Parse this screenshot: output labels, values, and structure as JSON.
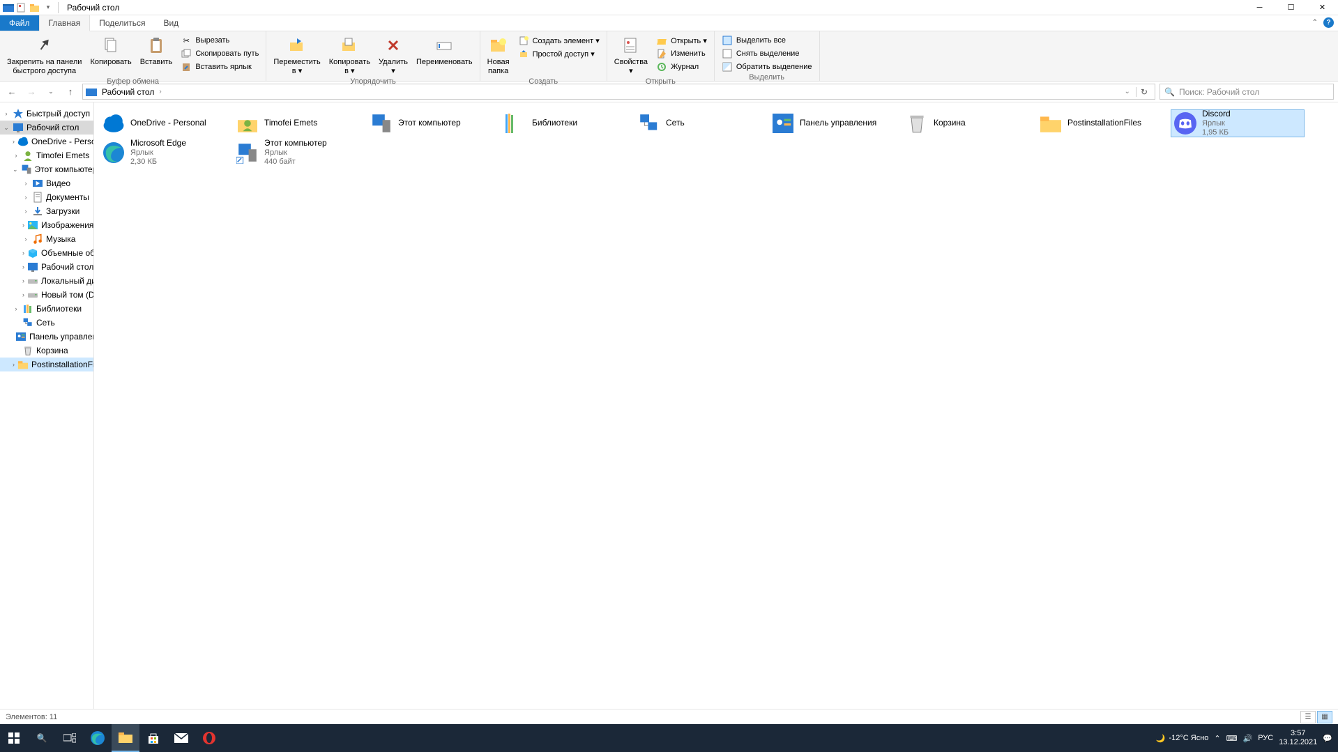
{
  "title": "Рабочий стол",
  "tabs": {
    "file": "Файл",
    "home": "Главная",
    "share": "Поделиться",
    "view": "Вид"
  },
  "ribbon": {
    "clipboard": {
      "title": "Буфер обмена",
      "pin": "Закрепить на панели\nбыстрого доступа",
      "copy": "Копировать",
      "paste": "Вставить",
      "cut": "Вырезать",
      "copypath": "Скопировать путь",
      "pastelnk": "Вставить ярлык"
    },
    "organize": {
      "title": "Упорядочить",
      "moveto": "Переместить\nв ▾",
      "copyto": "Копировать\nв ▾",
      "delete": "Удалить\n▾",
      "rename": "Переименовать"
    },
    "create": {
      "title": "Создать",
      "newfolder": "Новая\nпапка",
      "newitem": "Создать элемент ▾",
      "easyaccess": "Простой доступ ▾"
    },
    "open": {
      "title": "Открыть",
      "properties": "Свойства\n▾",
      "open": "Открыть ▾",
      "edit": "Изменить",
      "history": "Журнал"
    },
    "select": {
      "title": "Выделить",
      "selectall": "Выделить все",
      "selectnone": "Снять выделение",
      "invert": "Обратить выделение"
    }
  },
  "address": {
    "location": "Рабочий стол",
    "search_placeholder": "Поиск: Рабочий стол"
  },
  "tree": [
    {
      "label": "Быстрый доступ",
      "indent": 0,
      "chev": "›",
      "icon": "star"
    },
    {
      "label": "Рабочий стол",
      "indent": 0,
      "chev": "⌄",
      "icon": "desktop",
      "sel": "navsel"
    },
    {
      "label": "OneDrive - Personal",
      "indent": 1,
      "chev": "›",
      "icon": "cloud"
    },
    {
      "label": "Timofei Emets",
      "indent": 1,
      "chev": "›",
      "icon": "user"
    },
    {
      "label": "Этот компьютер",
      "indent": 1,
      "chev": "⌄",
      "icon": "pc"
    },
    {
      "label": "Видео",
      "indent": 2,
      "chev": "›",
      "icon": "video"
    },
    {
      "label": "Документы",
      "indent": 2,
      "chev": "›",
      "icon": "doc"
    },
    {
      "label": "Загрузки",
      "indent": 2,
      "chev": "›",
      "icon": "download"
    },
    {
      "label": "Изображения",
      "indent": 2,
      "chev": "›",
      "icon": "image"
    },
    {
      "label": "Музыка",
      "indent": 2,
      "chev": "›",
      "icon": "music"
    },
    {
      "label": "Объемные объекты",
      "indent": 2,
      "chev": "›",
      "icon": "3d"
    },
    {
      "label": "Рабочий стол",
      "indent": 2,
      "chev": "›",
      "icon": "desktop"
    },
    {
      "label": "Локальный диск (C:)",
      "indent": 2,
      "chev": "›",
      "icon": "disk"
    },
    {
      "label": "Новый том (D:)",
      "indent": 2,
      "chev": "›",
      "icon": "disk"
    },
    {
      "label": "Библиотеки",
      "indent": 1,
      "chev": "›",
      "icon": "library"
    },
    {
      "label": "Сеть",
      "indent": 1,
      "chev": "",
      "icon": "network"
    },
    {
      "label": "Панель управления",
      "indent": 1,
      "chev": "",
      "icon": "control"
    },
    {
      "label": "Корзина",
      "indent": 1,
      "chev": "",
      "icon": "bin"
    },
    {
      "label": "PostinstallationFiles",
      "indent": 1,
      "chev": "›",
      "icon": "folder",
      "sel": "selected"
    }
  ],
  "items": [
    {
      "name": "OneDrive - Personal",
      "icon": "cloud"
    },
    {
      "name": "Timofei Emets",
      "icon": "userfolder"
    },
    {
      "name": "Этот компьютер",
      "icon": "pc"
    },
    {
      "name": "Библиотеки",
      "icon": "library"
    },
    {
      "name": "Сеть",
      "icon": "network"
    },
    {
      "name": "Панель управления",
      "icon": "control"
    },
    {
      "name": "Корзина",
      "icon": "bin"
    },
    {
      "name": "PostinstallationFiles",
      "icon": "folder"
    },
    {
      "name": "Discord",
      "sub1": "Ярлык",
      "sub2": "1,95 КБ",
      "icon": "discord",
      "selected": true
    },
    {
      "name": "Microsoft Edge",
      "sub1": "Ярлык",
      "sub2": "2,30 КБ",
      "icon": "edge"
    },
    {
      "name": "Этот компьютер",
      "sub1": "Ярлык",
      "sub2": "440 байт",
      "icon": "pclnk"
    }
  ],
  "status": "Элементов: 11",
  "taskbar": {
    "weather": "-12°C  Ясно",
    "lang": "РУС",
    "time": "3:57",
    "date": "13.12.2021"
  }
}
